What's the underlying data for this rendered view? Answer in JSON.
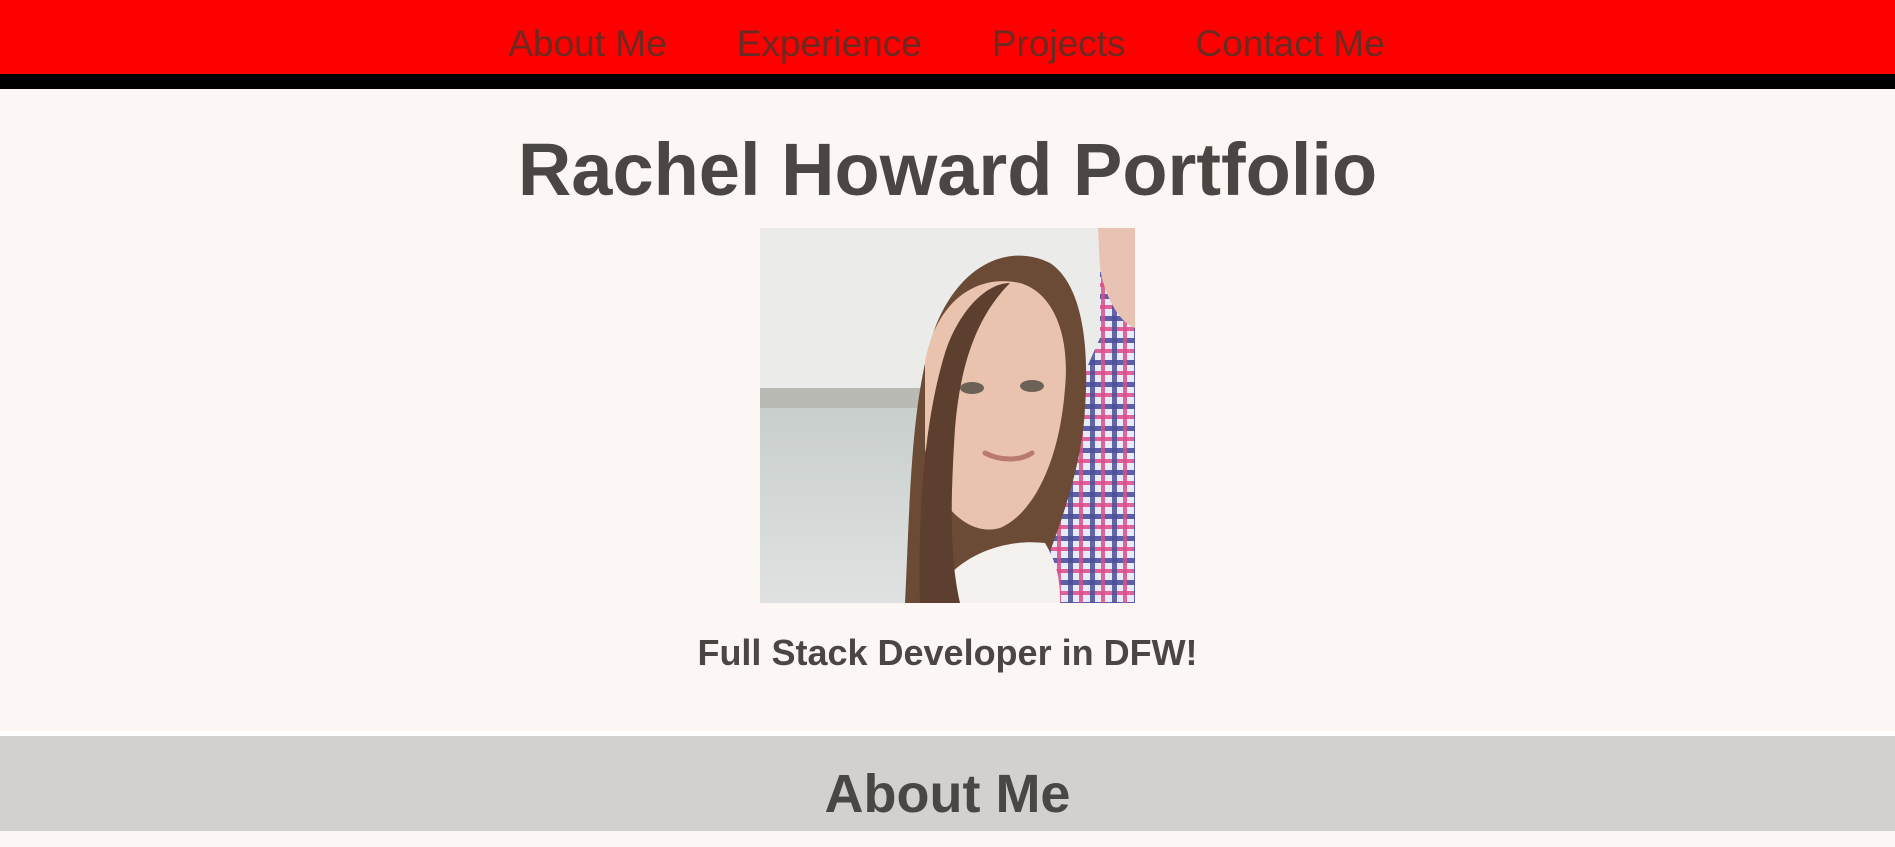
{
  "nav": {
    "items": [
      {
        "label": "About Me"
      },
      {
        "label": "Experience"
      },
      {
        "label": "Projects"
      },
      {
        "label": "Contact Me"
      }
    ]
  },
  "hero": {
    "title": "Rachel Howard Portfolio",
    "tagline": "Full Stack Developer in DFW!"
  },
  "about": {
    "heading": "About Me"
  },
  "colors": {
    "nav_background": "#ff0000",
    "nav_border": "#000000",
    "page_background": "#fcf7f4",
    "text": "#4a4644",
    "about_background": "#d3d1d0"
  }
}
